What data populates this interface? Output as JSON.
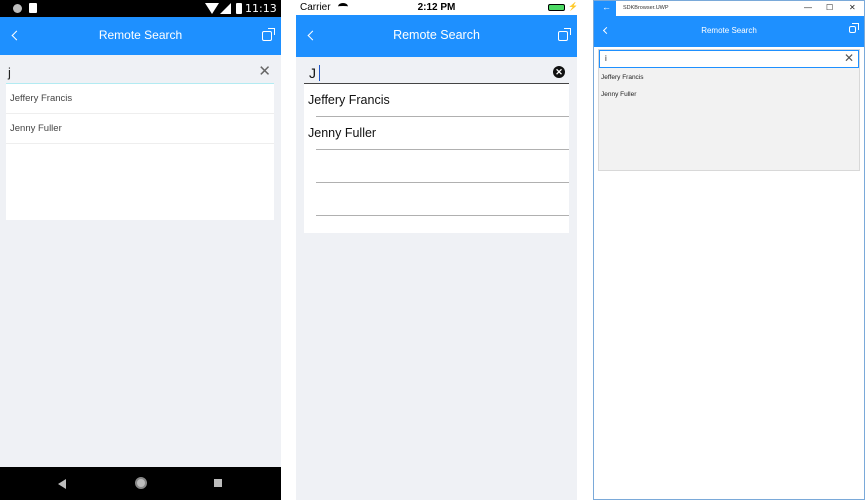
{
  "android": {
    "status_time": "11:13",
    "nav_title": "Remote Search",
    "search_value": "j",
    "results": [
      "Jeffery Francis",
      "Jenny Fuller"
    ]
  },
  "ios": {
    "carrier": "Carrier",
    "status_time": "2:12 PM",
    "nav_title": "Remote Search",
    "search_value": "J",
    "results": [
      "Jeffery Francis",
      "Jenny Fuller"
    ]
  },
  "uwp": {
    "window_title": "SDKBrowser.UWP",
    "nav_title": "Remote Search",
    "search_value": "i",
    "results": [
      "Jeffery Francis",
      "Jenny Fuller"
    ]
  },
  "icons": {
    "back": "chevron-left-icon",
    "share": "external-link-icon",
    "clear": "close-icon"
  },
  "colors": {
    "accent": "#1e90ff",
    "background": "#eff1f5"
  }
}
